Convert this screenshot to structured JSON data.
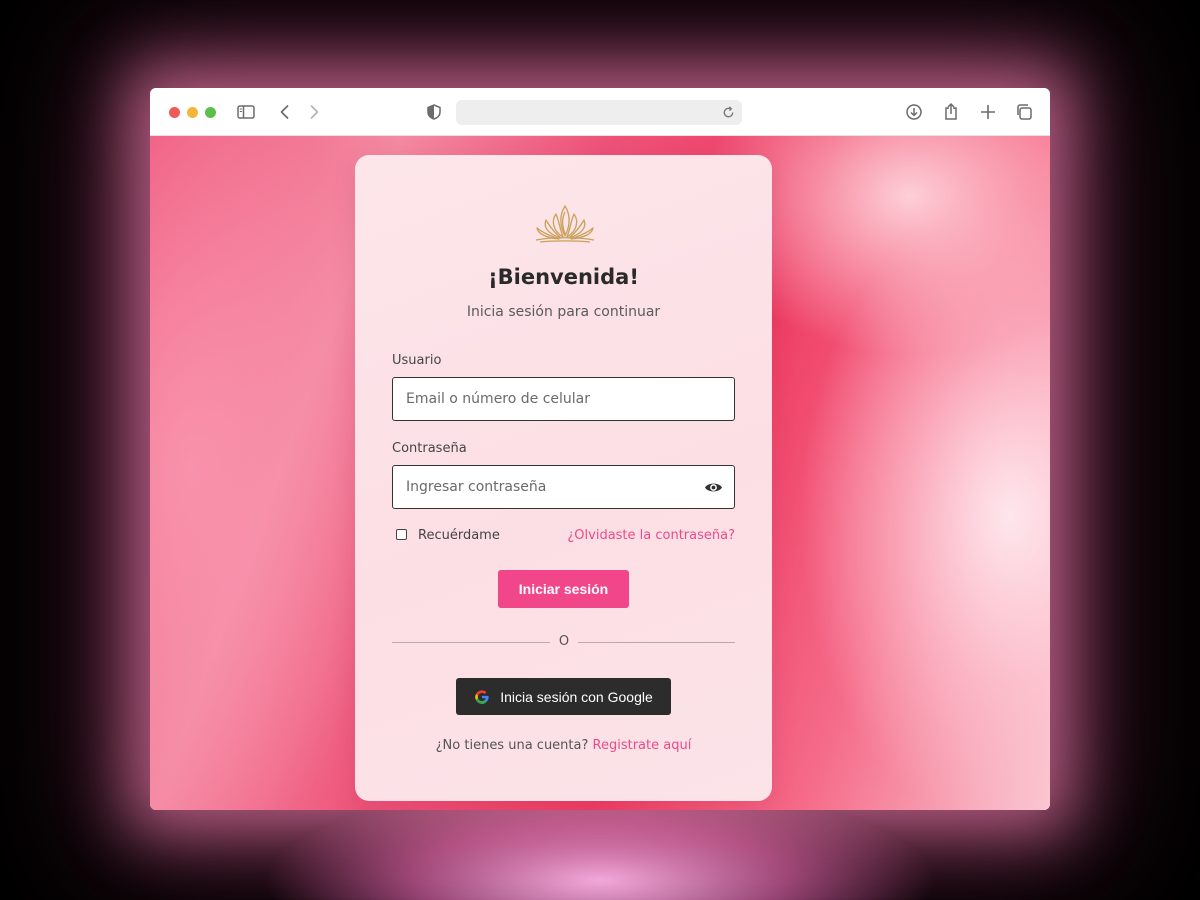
{
  "browser": {
    "url": "",
    "icons": [
      "sidebar-icon",
      "back-icon",
      "forward-icon",
      "privacy-shield-icon",
      "reload-icon",
      "download-icon",
      "share-icon",
      "new-tab-icon",
      "tab-overview-icon"
    ]
  },
  "login": {
    "logo_icon": "crown-icon",
    "title": "¡Bienvenida!",
    "subtitle": "Inicia sesión para continuar",
    "user_label": "Usuario",
    "user_placeholder": "Email o número de celular",
    "password_label": "Contraseña",
    "password_placeholder": "Ingresar contraseña",
    "remember_label": "Recuérdame",
    "remember_checked": false,
    "forgot_link": "¿Olvidaste la contraseña?",
    "submit_label": "Iniciar sesión",
    "divider_text": "O",
    "google_label": "Inicia sesión con Google",
    "signup_prompt": "¿No tienes una cuenta?",
    "signup_link": "Registrate aquí"
  },
  "colors": {
    "accent": "#f2468a",
    "link": "#ee4a87",
    "google_button": "#2c2c2c"
  }
}
